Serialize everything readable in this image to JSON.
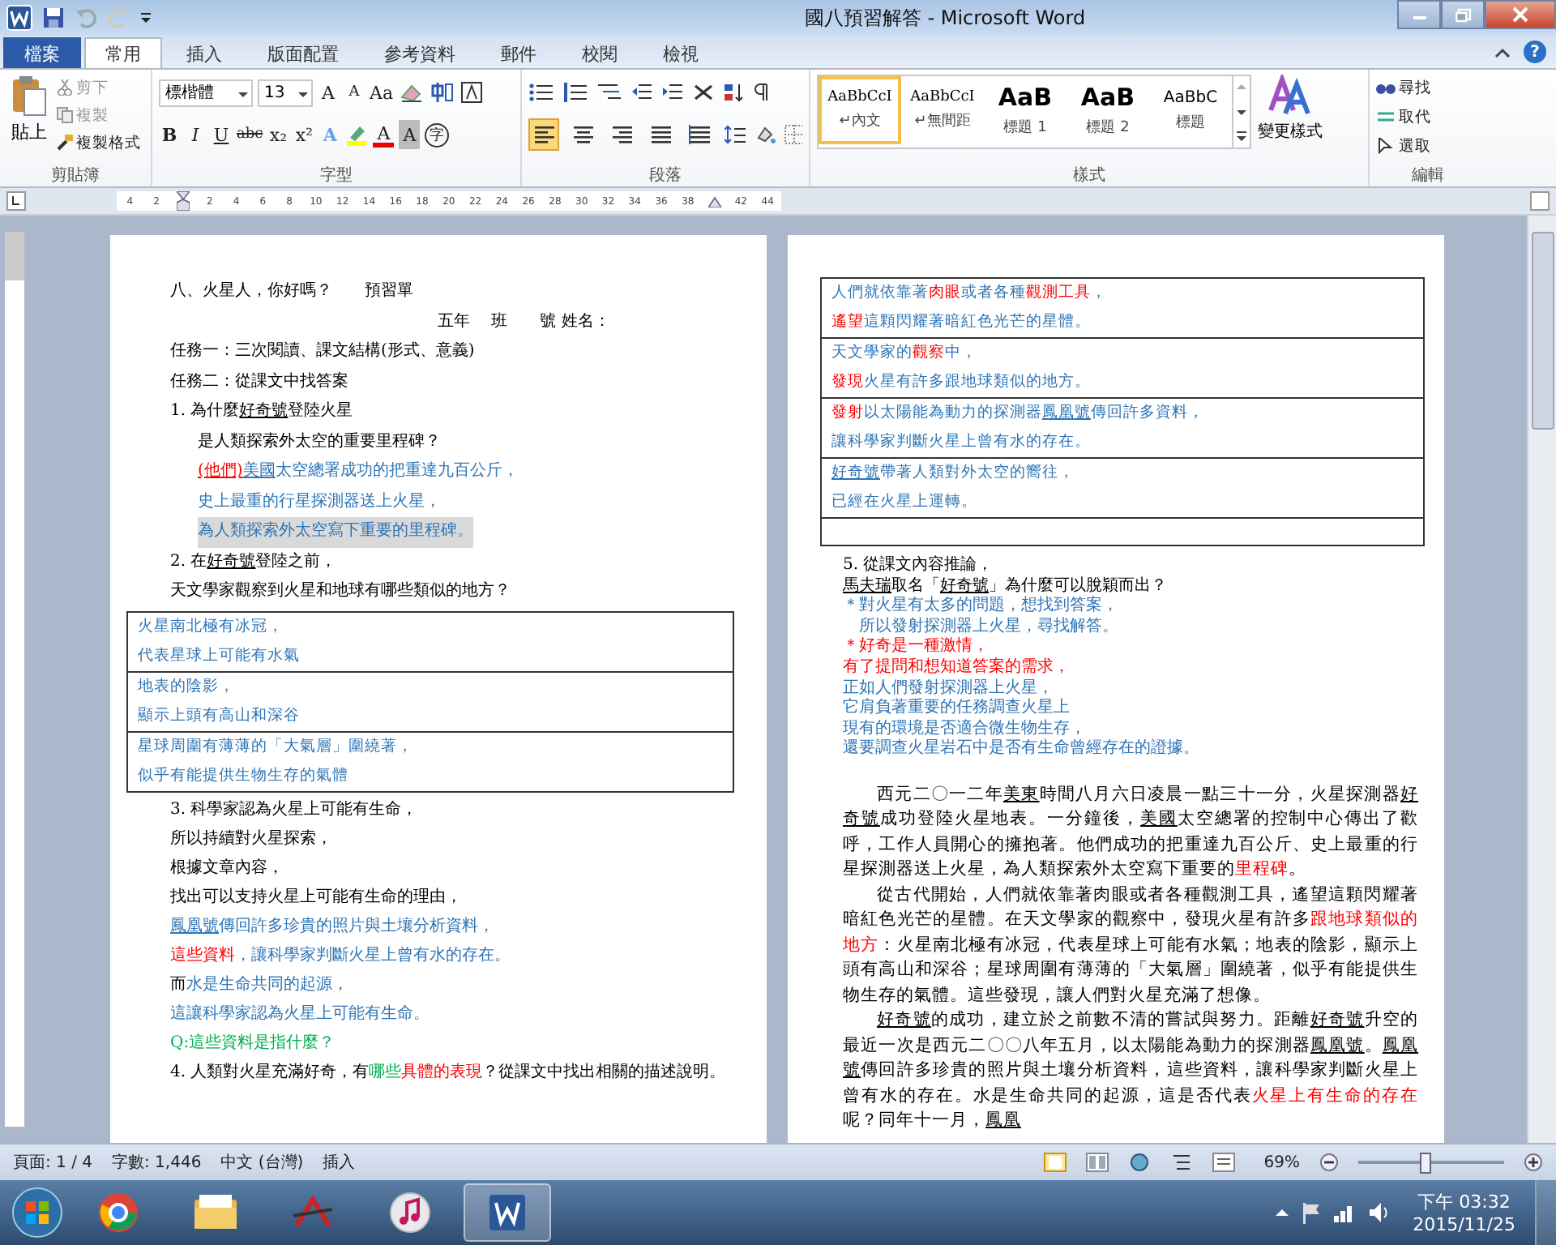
{
  "window": {
    "title": "國八預習解答 - Microsoft Word",
    "help": "?"
  },
  "tabs": [
    {
      "label": "檔案",
      "kind": "file",
      "selected": false
    },
    {
      "label": "常用",
      "kind": "tab",
      "selected": true
    },
    {
      "label": "插入",
      "kind": "tab",
      "selected": false
    },
    {
      "label": "版面配置",
      "kind": "tab",
      "selected": false
    },
    {
      "label": "參考資料",
      "kind": "tab",
      "selected": false
    },
    {
      "label": "郵件",
      "kind": "tab",
      "selected": false
    },
    {
      "label": "校閱",
      "kind": "tab",
      "selected": false
    },
    {
      "label": "檢視",
      "kind": "tab",
      "selected": false
    }
  ],
  "ribbon": {
    "clipboard": {
      "label": "剪貼簿",
      "paste": "貼上",
      "items": [
        {
          "label": "剪下",
          "disabled": true
        },
        {
          "label": "複製",
          "disabled": true
        },
        {
          "label": "複製格式",
          "disabled": false
        }
      ]
    },
    "font": {
      "label": "字型",
      "font_name": "標楷體",
      "font_size": "13",
      "top_buttons": [
        "A",
        "A",
        "Aa"
      ],
      "format_buttons": [
        "B",
        "I",
        "U",
        "abc",
        "x₂",
        "x²"
      ],
      "color_buttons": [
        "A",
        "A",
        "A"
      ],
      "enclose": "字"
    },
    "paragraph": {
      "label": "段落",
      "alignment_buttons": [
        {
          "kind": "left",
          "selected": true
        },
        {
          "kind": "center",
          "selected": false
        },
        {
          "kind": "right",
          "selected": false
        },
        {
          "kind": "justify",
          "selected": false
        },
        {
          "kind": "distributed",
          "selected": false
        }
      ]
    },
    "styles": {
      "label": "樣式",
      "change": "變更樣式",
      "items": [
        {
          "preview": "AaBbCcI",
          "name": "↵內文",
          "kind": "normal",
          "selected": true
        },
        {
          "preview": "AaBbCcI",
          "name": "↵無間距",
          "kind": "normal",
          "selected": false
        },
        {
          "preview": "AaB",
          "name": "標題 1",
          "kind": "heading",
          "selected": false
        },
        {
          "preview": "AaB",
          "name": "標題 2",
          "kind": "heading",
          "selected": false
        },
        {
          "preview": "AaBbC",
          "name": "標題",
          "kind": "title",
          "selected": false
        }
      ]
    },
    "editing": {
      "label": "編輯",
      "items": [
        "尋找",
        "取代",
        "選取"
      ]
    }
  },
  "ruler": [
    {
      "label": "4"
    },
    {
      "label": "2"
    },
    {
      "kind": "indent_marker"
    },
    {
      "label": "2"
    },
    {
      "label": "4"
    },
    {
      "label": "6"
    },
    {
      "label": "8"
    },
    {
      "label": "10"
    },
    {
      "label": "12"
    },
    {
      "label": "14"
    },
    {
      "label": "16"
    },
    {
      "label": "18"
    },
    {
      "label": "20"
    },
    {
      "label": "22"
    },
    {
      "label": "24"
    },
    {
      "label": "26"
    },
    {
      "label": "28"
    },
    {
      "label": "30"
    },
    {
      "label": "32"
    },
    {
      "label": "34"
    },
    {
      "label": "36"
    },
    {
      "label": "38"
    },
    {
      "kind": "right_marker"
    },
    {
      "label": "42"
    },
    {
      "label": "44"
    }
  ],
  "left_page": {
    "lines_before": [
      {
        "kind": "plain",
        "text": "八、火星人，你好嗎？　　預習單"
      },
      {
        "kind": "center",
        "text": "五年　 班　　號 姓名："
      },
      {
        "kind": "plain",
        "text": "任務一：三次閱讀、課文結構(形式、意義)"
      },
      {
        "kind": "plain",
        "text": "任務二：從課文中找答案"
      },
      {
        "kind": "plain",
        "segments": [
          {
            "text": "1. 為什麼"
          },
          {
            "text": "好奇號",
            "underline": true
          },
          {
            "text": "登陸火星"
          }
        ]
      },
      {
        "kind": "indent",
        "text": "是人類探索外太空的重要里程碑？"
      },
      {
        "kind": "indent",
        "segments": [
          {
            "text": "(他們)",
            "color": "#ff0000",
            "underline": true
          },
          {
            "text": "美國",
            "color": "#2e75b6",
            "underline": true
          },
          {
            "text": "太空總署成功的把重達九百公斤，",
            "color": "#2e75b6"
          }
        ]
      },
      {
        "kind": "indent",
        "text": "史上最重的行星探測器送上火星，",
        "color": "#2e75b6"
      },
      {
        "kind": "indent",
        "text": "為人類探索外太空寫下重要的里程碑。",
        "color": "#2e75b6",
        "highlight": true
      },
      {
        "kind": "plain",
        "segments": [
          {
            "text": "2. 在"
          },
          {
            "text": "好奇號",
            "underline": true
          },
          {
            "text": "登陸之前，"
          }
        ]
      },
      {
        "kind": "plain",
        "text": "天文學家觀察到火星和地球有哪些類似的地方？"
      }
    ],
    "table": [
      {
        "lines": [
          {
            "text": "火星南北極有冰冠，",
            "color": "#2e75b6"
          },
          {
            "text": "代表星球上可能有水氣",
            "color": "#2e75b6"
          }
        ]
      },
      {
        "lines": [
          {
            "text": "地表的陰影，",
            "color": "#2e75b6"
          },
          {
            "text": "顯示上頭有高山和深谷",
            "color": "#2e75b6"
          }
        ]
      },
      {
        "lines": [
          {
            "text": "星球周圍有薄薄的「大氣層」圍繞著，",
            "color": "#2e75b6"
          },
          {
            "text": "似乎有能提供生物生存的氣體",
            "color": "#2e75b6"
          }
        ]
      }
    ],
    "lines_after": [
      {
        "kind": "plain",
        "text": "3. 科學家認為火星上可能有生命，"
      },
      {
        "kind": "plain",
        "text": "所以持續對火星探索，"
      },
      {
        "kind": "plain",
        "text": "根據文章內容，"
      },
      {
        "kind": "plain",
        "text": "找出可以支持火星上可能有生命的理由，"
      },
      {
        "kind": "plain",
        "segments": [
          {
            "text": "鳳凰號",
            "color": "#2e75b6",
            "underline": true
          },
          {
            "text": "傳回許多珍貴的照片與土壤分析資料，",
            "color": "#2e75b6"
          }
        ]
      },
      {
        "kind": "plain",
        "segments": [
          {
            "text": "這些資料",
            "color": "#ff0000"
          },
          {
            "text": "，讓科學家判斷火星上曾有水的存在。",
            "color": "#2e75b6"
          }
        ]
      },
      {
        "kind": "plain",
        "segments": [
          {
            "text": "而"
          },
          {
            "text": "水是生命共同的起源，",
            "color": "#2e75b6"
          }
        ]
      },
      {
        "kind": "plain",
        "text": "這讓科學家認為火星上可能有生命。",
        "color": "#2e75b6"
      },
      {
        "kind": "plain",
        "text": "Q:這些資料是指什麼？",
        "color": "#00b050"
      },
      {
        "kind": "plain",
        "segments": [
          {
            "text": "4. 人類對火星充滿好奇，有"
          },
          {
            "text": "哪些",
            "color": "#00b050"
          },
          {
            "text": "具體的表現",
            "color": "#ff0000"
          },
          {
            "text": "？從課文中找出相關的描述說明。"
          }
        ]
      }
    ]
  },
  "right_page": {
    "table": [
      {
        "lines": [
          {
            "color": "#2e75b6",
            "segments": [
              {
                "text": "人們就依靠著"
              },
              {
                "text": "肉眼",
                "color": "#ff0000"
              },
              {
                "text": "或者各種"
              },
              {
                "text": "觀測工具",
                "color": "#ff0000"
              },
              {
                "text": "，"
              }
            ]
          },
          {
            "segments": [
              {
                "text": "遙望",
                "color": "#ff0000"
              },
              {
                "text": "這顆閃耀著暗紅色光芒的星體。",
                "color": "#2e75b6"
              }
            ]
          }
        ]
      },
      {
        "lines": [
          {
            "segments": [
              {
                "text": "天文學家的",
                "color": "#2e75b6"
              },
              {
                "text": "觀察",
                "color": "#ff0000"
              },
              {
                "text": "中，",
                "color": "#2e75b6"
              }
            ]
          },
          {
            "segments": [
              {
                "text": "發現",
                "color": "#ff0000"
              },
              {
                "text": "火星有許多跟地球類似的地方。",
                "color": "#2e75b6"
              }
            ]
          }
        ]
      },
      {
        "lines": [
          {
            "segments": [
              {
                "text": "發射",
                "color": "#ff0000"
              },
              {
                "text": "以太陽能為動力的探測器",
                "color": "#2e75b6"
              },
              {
                "text": "鳳凰號",
                "color": "#2e75b6",
                "underline": true
              },
              {
                "text": "傳回許多資料，",
                "color": "#2e75b6"
              }
            ]
          },
          {
            "text": "讓科學家判斷火星上曾有水的存在。",
            "color": "#2e75b6"
          }
        ]
      },
      {
        "lines": [
          {
            "segments": [
              {
                "text": "好奇號",
                "color": "#2e75b6",
                "underline": true
              },
              {
                "text": "帶著人類對外太空的嚮往，",
                "color": "#2e75b6"
              }
            ]
          },
          {
            "text": "已經在火星上運轉。",
            "color": "#2e75b6"
          }
        ]
      }
    ],
    "empty_row": true,
    "lines": [
      {
        "kind": "plain",
        "text": "5. 從課文內容推論，"
      },
      {
        "kind": "plain",
        "segments": [
          {
            "text": "馬夫瑞",
            "underline": true
          },
          {
            "text": "取名「"
          },
          {
            "text": "好奇號",
            "underline": true
          },
          {
            "text": "」為什麼可以脫穎而出？"
          }
        ]
      },
      {
        "kind": "plain",
        "text": "＊對火星有太多的問題，想找到答案，",
        "color": "#2e75b6"
      },
      {
        "kind": "indent",
        "text": "所以發射探測器上火星，尋找解答。",
        "color": "#2e75b6"
      },
      {
        "kind": "plain",
        "text": "＊好奇是一種激情，",
        "color": "#ff0000"
      },
      {
        "kind": "plain",
        "text": "有了提問和想知道答案的需求，",
        "color": "#ff0000"
      },
      {
        "kind": "plain",
        "text": "正如人們發射探測器上火星，",
        "color": "#2e75b6"
      },
      {
        "kind": "plain",
        "text": "它肩負著重要的任務調查火星上",
        "color": "#2e75b6"
      },
      {
        "kind": "plain",
        "text": "現有的環境是否適合微生物生存，",
        "color": "#2e75b6"
      },
      {
        "kind": "plain",
        "text": "還要調查火星岩石中是否有生命曾經存在的證據。",
        "color": "#2e75b6"
      }
    ],
    "paragraphs": [
      {
        "segments": [
          {
            "text": "西元二〇一二年"
          },
          {
            "text": "美東",
            "underline": true
          },
          {
            "text": "時間八月六日凌晨一點三十一分，火星探測器"
          },
          {
            "text": "好奇號",
            "underline": true
          },
          {
            "text": "成功登陸火星地表。一分鐘後，"
          },
          {
            "text": "美國",
            "underline": true
          },
          {
            "text": "太空總署的控制中心傳出了歡呼，工作人員開心的擁抱著。他們成功的把重達九百公斤、史上最重的行星探測器送上火星，為人類探索外太空寫下重要的"
          },
          {
            "text": "里程碑",
            "color": "#ff0000"
          },
          {
            "text": "。"
          }
        ]
      },
      {
        "segments": [
          {
            "text": "從古代開始，人們就依靠著肉眼或者各種觀測工具，遙望這顆閃耀著暗紅色光芒的星體。在天文學家的觀察中，發現火星有許多"
          },
          {
            "text": "跟地球類似的地方",
            "color": "#ff0000"
          },
          {
            "text": "：火星南北極有冰冠，代表星球上可能有水氣；地表的陰影，顯示上頭有高山和深谷；星球周圍有薄薄的「大氣層」圍繞著，似乎有能提供生物生存的氣體。這些發現，讓人們對火星充滿了想像。"
          }
        ]
      },
      {
        "segments": [
          {
            "text": "好奇號",
            "underline": true
          },
          {
            "text": "的成功，建立於之前數不清的嘗試與努力。距離"
          },
          {
            "text": "好奇號",
            "underline": true
          },
          {
            "text": "升空的最近一次是西元二〇〇八年五月，以太陽能為動力的探測器"
          },
          {
            "text": "鳳凰號",
            "underline": true
          },
          {
            "text": "。"
          },
          {
            "text": "鳳凰號",
            "underline": true
          },
          {
            "text": "傳回許多珍貴的照片與土壤分析資料，這些資料，讓科學家判斷火星上曾有水的存在。水是生命共同的起源，這是否代表"
          },
          {
            "text": "火星上有生命的存在",
            "color": "#ff0000"
          },
          {
            "text": "呢？同年十一月，"
          },
          {
            "text": "鳳凰",
            "underline": true
          }
        ]
      }
    ]
  },
  "status_bar": {
    "page": "頁面: 1 / 4",
    "words": "字數: 1,446",
    "language": "中文 (台灣)",
    "mode": "插入",
    "zoom": "69%",
    "zoom_slider": {
      "level": 0.45
    }
  },
  "taskbar": {
    "apps": [
      {
        "kind": "browser",
        "selected": false
      },
      {
        "kind": "folder",
        "selected": false
      },
      {
        "kind": "acrobat",
        "selected": false
      },
      {
        "kind": "music",
        "selected": false
      },
      {
        "kind": "word",
        "selected": true
      }
    ],
    "time": "下午 03:32",
    "date": "2015/11/25"
  }
}
